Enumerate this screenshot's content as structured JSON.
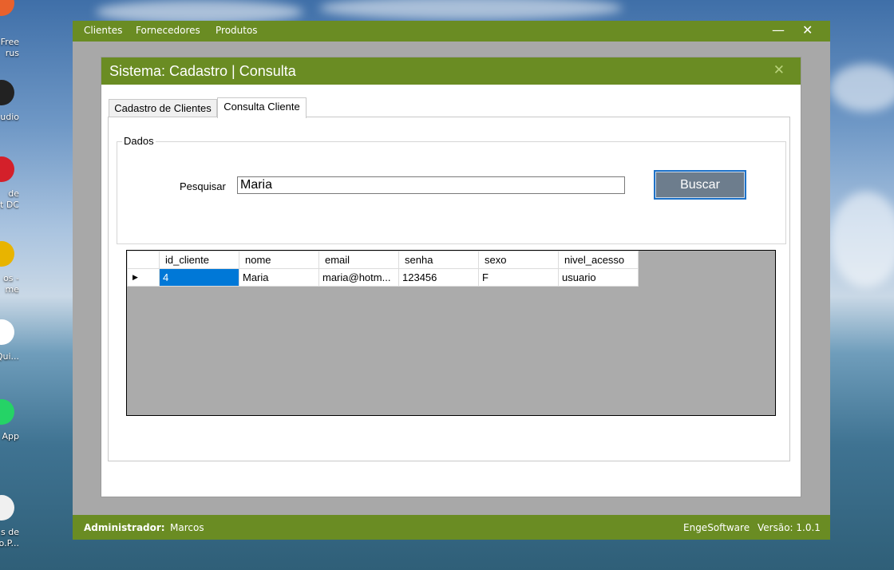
{
  "desktop": {
    "icons": [
      {
        "label": "Free\nrus",
        "color": "#e8612c"
      },
      {
        "label": "udio",
        "color": "#222222"
      },
      {
        "label": "de\nt DC",
        "color": "#d4202a"
      },
      {
        "label": "os -\nme",
        "color": "#e8b400"
      },
      {
        "label": "Qui...",
        "color": "#ffffff"
      },
      {
        "label": "App",
        "color": "#25d366"
      },
      {
        "label": "s de\não.P...",
        "color": "#f0f0f0"
      }
    ]
  },
  "menubar": {
    "items": [
      "Clientes",
      "Fornecedores",
      "Produtos"
    ],
    "minimize": "—",
    "close": "✕"
  },
  "child": {
    "title": "Sistema: Cadastro | Consulta",
    "close": "✕",
    "tabs": [
      "Cadastro de Clientes",
      "Consulta Cliente"
    ],
    "group_title": "Dados",
    "search_label": "Pesquisar",
    "search_value": "Maria",
    "button_label": "Buscar"
  },
  "grid": {
    "columns": [
      "id_cliente",
      "nome",
      "email",
      "senha",
      "sexo",
      "nivel_acesso"
    ],
    "rows": [
      [
        "4",
        "Maria",
        "maria@hotm...",
        "123456",
        "F",
        "usuario"
      ]
    ],
    "current_row_marker": "▶"
  },
  "statusbar": {
    "role_label": "Administrador:",
    "user": "Marcos",
    "company": "EngeSoftware",
    "version": "Versão: 1.0.1"
  },
  "colors": {
    "accent_green": "#6a8c23",
    "button": "#6d7d8d",
    "selection": "#0078d7"
  }
}
